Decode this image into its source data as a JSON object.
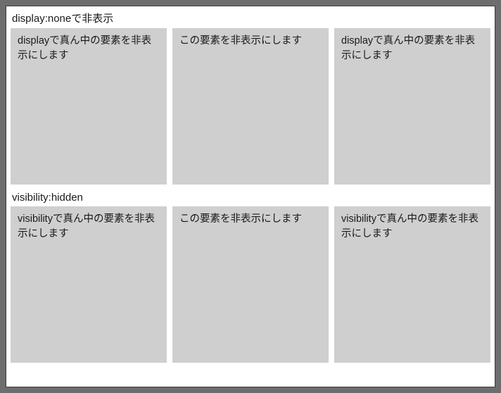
{
  "sections": [
    {
      "heading": "display:noneで非表示",
      "boxes": [
        "displayで真ん中の要素を非表示にします",
        "この要素を非表示にします",
        "displayで真ん中の要素を非表示にします"
      ]
    },
    {
      "heading": "visibility:hidden",
      "boxes": [
        "visibilityで真ん中の要素を非表示にします",
        "この要素を非表示にします",
        "visibilityで真ん中の要素を非表示にします"
      ]
    }
  ]
}
